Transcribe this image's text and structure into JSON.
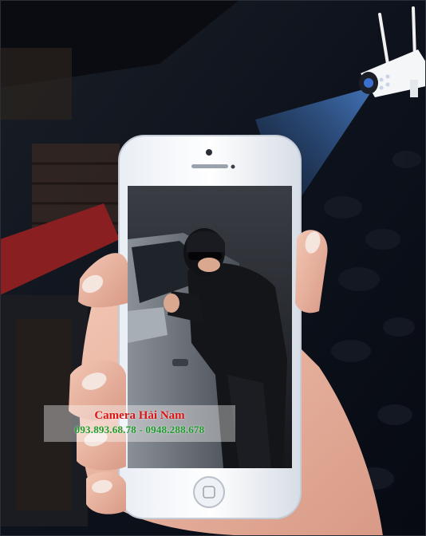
{
  "watermark": {
    "brand": "Camera Hải Nam",
    "phones": "093.893.68.78 - 0948.288.678"
  },
  "colors": {
    "brand_red": "#d81616",
    "phone_green": "#1e9a2a",
    "background": "#0b0f18",
    "camera_beam": "#3c6fb4"
  },
  "icons": {
    "camera": "security-camera-icon",
    "phone": "smartphone-icon",
    "home_button": "home-button-icon"
  }
}
